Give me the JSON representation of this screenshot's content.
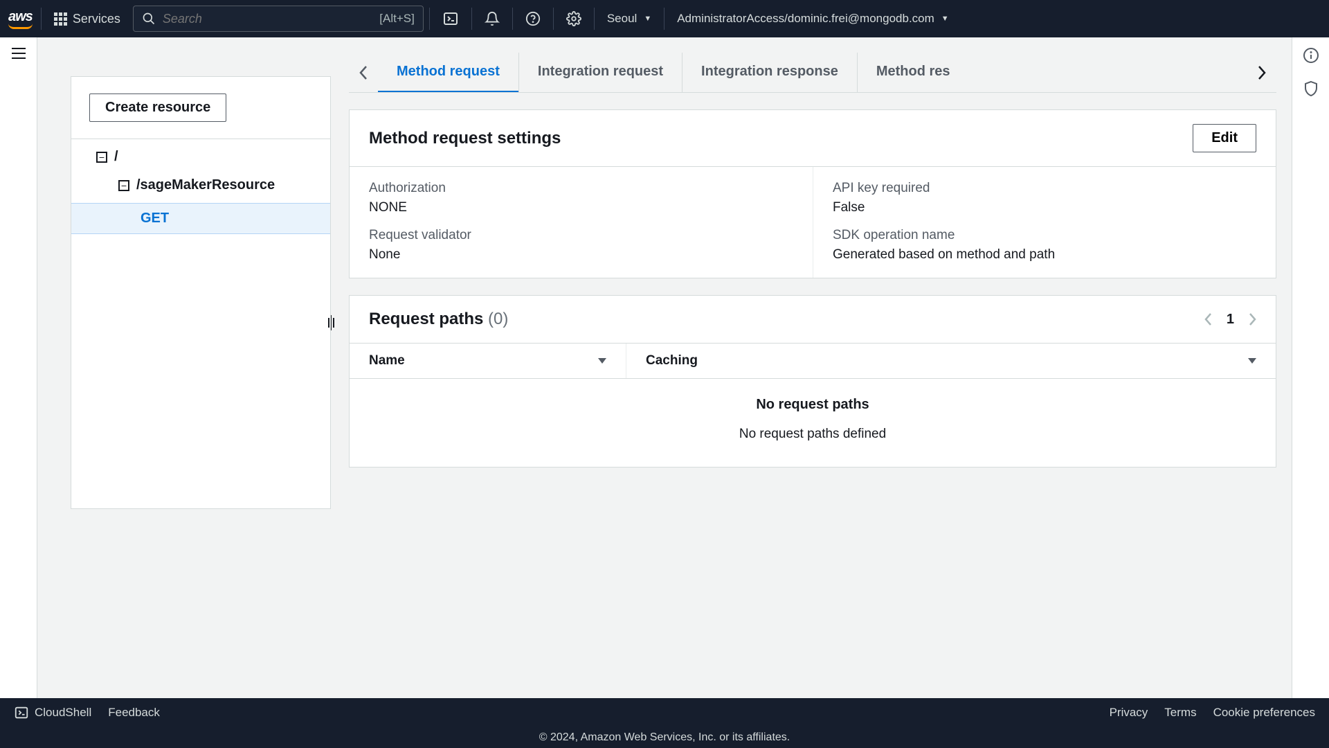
{
  "topnav": {
    "services_label": "Services",
    "search_placeholder": "Search",
    "search_shortcut": "[Alt+S]",
    "region": "Seoul",
    "account": "AdministratorAccess/dominic.frei@mongodb.com"
  },
  "sidebar": {
    "create_resource_label": "Create resource",
    "root_label": "/",
    "resource_label": "/sageMakerResource",
    "method_label": "GET"
  },
  "tabs": [
    "Method request",
    "Integration request",
    "Integration response",
    "Method res"
  ],
  "method_request": {
    "panel_title": "Method request settings",
    "edit_label": "Edit",
    "settings": {
      "authorization_label": "Authorization",
      "authorization_value": "NONE",
      "api_key_required_label": "API key required",
      "api_key_required_value": "False",
      "request_validator_label": "Request validator",
      "request_validator_value": "None",
      "sdk_operation_label": "SDK operation name",
      "sdk_operation_value": "Generated based on method and path"
    }
  },
  "request_paths": {
    "title": "Request paths",
    "count": "(0)",
    "page": "1",
    "columns": {
      "name": "Name",
      "caching": "Caching"
    },
    "empty_title": "No request paths",
    "empty_sub": "No request paths defined"
  },
  "footer": {
    "cloudshell": "CloudShell",
    "feedback": "Feedback",
    "privacy": "Privacy",
    "terms": "Terms",
    "cookie": "Cookie preferences",
    "copyright": "© 2024, Amazon Web Services, Inc. or its affiliates."
  }
}
